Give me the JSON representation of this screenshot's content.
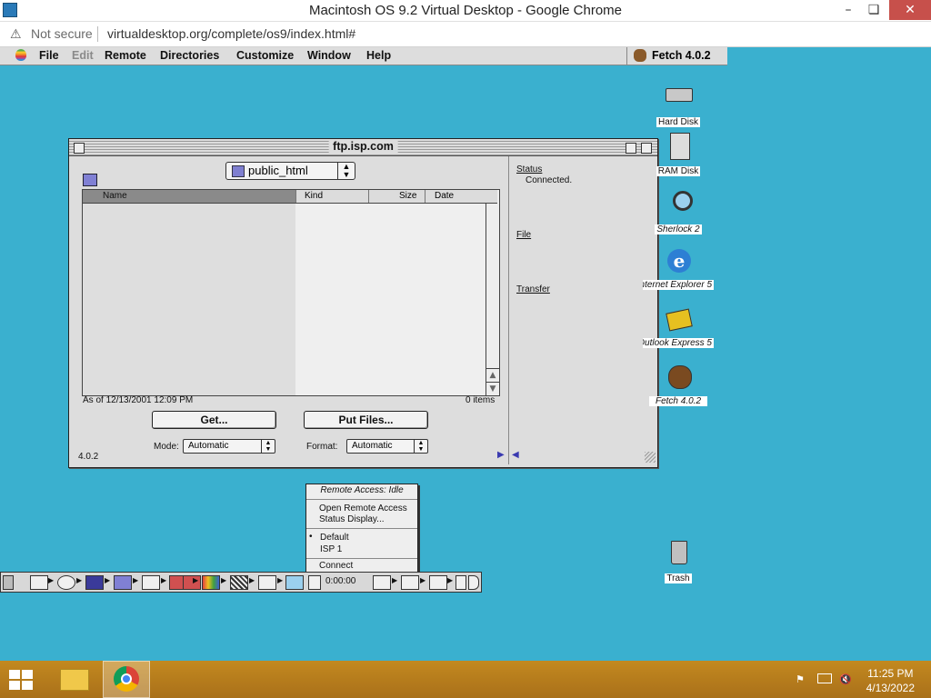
{
  "browser": {
    "title": "Macintosh OS 9.2 Virtual Desktop - Google Chrome",
    "minimize": "–",
    "restore": "❏",
    "close": "✕",
    "security_label": "Not secure",
    "url": "virtualdesktop.org/complete/os9/index.html#"
  },
  "menubar": {
    "items": [
      "File",
      "Edit",
      "Remote",
      "Directories",
      "Customize",
      "Window",
      "Help"
    ],
    "disabled": [
      "Edit"
    ],
    "app_switcher": "Fetch 4.0.2"
  },
  "fetch": {
    "title": "ftp.isp.com",
    "folder": "public_html",
    "columns": [
      "Name",
      "Kind",
      "Size",
      "Date"
    ],
    "as_of": "As of 12/13/2001 12:09 PM",
    "item_count": "0 items",
    "get_button": "Get...",
    "put_button": "Put Files...",
    "mode_label": "Mode:",
    "mode_value": "Automatic",
    "format_label": "Format:",
    "format_value": "Automatic",
    "version": "4.0.2",
    "status_heading": "Status",
    "status_value": "Connected.",
    "file_heading": "File",
    "transfer_heading": "Transfer"
  },
  "desktop_icons": [
    {
      "label": "Hard Disk",
      "icon": "hard-disk-icon"
    },
    {
      "label": "RAM Disk",
      "icon": "ram-disk-icon"
    },
    {
      "label": "Sherlock 2",
      "icon": "sherlock-icon"
    },
    {
      "label": "Internet Explorer 5",
      "icon": "internet-explorer-icon"
    },
    {
      "label": "Outlook Express 5",
      "icon": "outlook-express-icon"
    },
    {
      "label": "Fetch 4.0.2",
      "icon": "fetch-dog-icon"
    },
    {
      "label": "Trash",
      "icon": "trash-icon"
    }
  ],
  "remote_access_menu": {
    "header": "Remote Access: Idle",
    "open_line1": "Open Remote Access",
    "open_line2": "Status Display...",
    "default": "Default",
    "isp": "ISP 1",
    "connect": "Connect",
    "checked_marker": "•"
  },
  "control_strip": {
    "timer": "0:00:00"
  },
  "taskbar": {
    "time": "11:25 PM",
    "date": "4/13/2022"
  },
  "colors": {
    "desktop": "#3ab0cf",
    "taskbar": "#b87a1d",
    "close_button": "#c7504b"
  }
}
